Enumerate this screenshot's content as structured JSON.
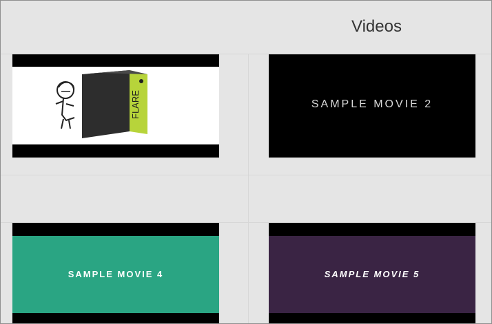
{
  "header": {
    "title": "Videos"
  },
  "videos": [
    {
      "label": ""
    },
    {
      "label": "SAMPLE MOVIE 2"
    },
    {
      "label": "SAMPLE MOVIE 4"
    },
    {
      "label": "SAMPLE MOVIE 5"
    }
  ],
  "logo_art": {
    "product_name": "FLARE"
  },
  "colors": {
    "page_background": "#e5e5e5",
    "divider": "#d7d7d7",
    "thumbnail_black": "#000000",
    "movie4_band": "#2aa583",
    "movie5_band": "#3a2444",
    "flare_box_dark": "#2d2d2d",
    "flare_box_lime": "#b7d43a"
  },
  "icons": {
    "thumbnail_1": "flare-product-box-with-character-art"
  }
}
